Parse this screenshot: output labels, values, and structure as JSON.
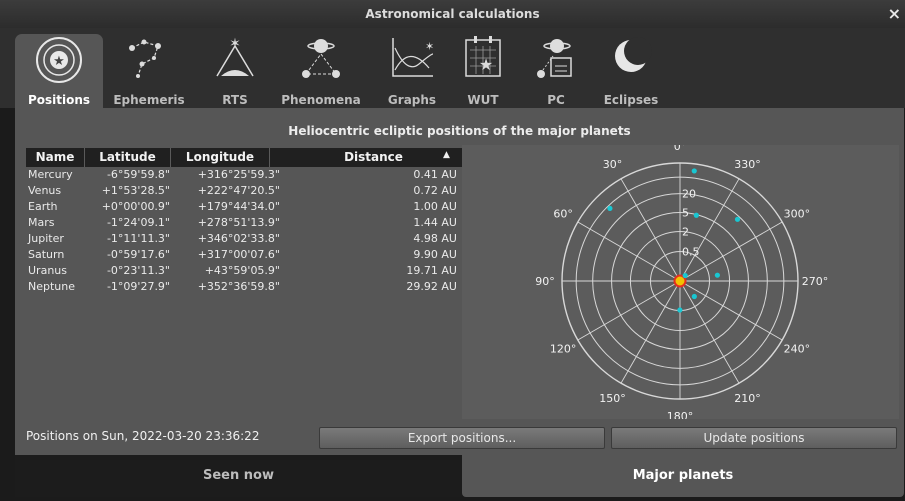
{
  "window": {
    "title": "Astronomical calculations",
    "close_glyph": "×"
  },
  "tabs": [
    {
      "label": "Positions",
      "icon": "solar-system-icon",
      "active": true
    },
    {
      "label": "Ephemeris",
      "icon": "constellation-icon"
    },
    {
      "label": "RTS",
      "icon": "rise-transit-set-icon"
    },
    {
      "label": "Phenomena",
      "icon": "conjunction-icon"
    },
    {
      "label": "Graphs",
      "icon": "graph-icon"
    },
    {
      "label": "WUT",
      "icon": "calendar-star-icon"
    },
    {
      "label": "PC",
      "icon": "planet-calendar-icon"
    },
    {
      "label": "Eclipses",
      "icon": "eclipse-icon"
    }
  ],
  "positions": {
    "heading": "Heliocentric ecliptic positions of the major planets",
    "columns": [
      "Name",
      "Latitude",
      "Longitude",
      "Distance"
    ],
    "rows": [
      {
        "name": "Mercury",
        "latitude": "-6°59'59.8\"",
        "longitude": "+316°25'59.3\"",
        "distance": "0.41 AU"
      },
      {
        "name": "Venus",
        "latitude": "+1°53'28.5\"",
        "longitude": "+222°47'20.5\"",
        "distance": "0.72 AU"
      },
      {
        "name": "Earth",
        "latitude": "+0°00'00.9\"",
        "longitude": "+179°44'34.0\"",
        "distance": "1.00 AU"
      },
      {
        "name": "Mars",
        "latitude": "-1°24'09.1\"",
        "longitude": "+278°51'13.9\"",
        "distance": "1.44 AU"
      },
      {
        "name": "Jupiter",
        "latitude": "-1°11'11.3\"",
        "longitude": "+346°02'33.8\"",
        "distance": "4.98 AU"
      },
      {
        "name": "Saturn",
        "latitude": "-0°59'17.6\"",
        "longitude": "+317°00'07.6\"",
        "distance": "9.90 AU"
      },
      {
        "name": "Uranus",
        "latitude": "-0°23'11.3\"",
        "longitude": "+43°59'05.9\"",
        "distance": "19.71 AU"
      },
      {
        "name": "Neptune",
        "latitude": "-1°09'27.9\"",
        "longitude": "+352°36'59.8\"",
        "distance": "29.92 AU"
      }
    ],
    "footer_text": "Positions on Sun, 2022-03-20 23:36:22",
    "export_label": "Export positions...",
    "update_label": "Update positions"
  },
  "chart_data": {
    "type": "scatter",
    "projection": "polar",
    "angle_labels": [
      "0°",
      "30°",
      "60°",
      "90°",
      "120°",
      "150°",
      "180°",
      "210°",
      "240°",
      "270°",
      "300°",
      "330°"
    ],
    "radial_labels": [
      "0.5",
      "2",
      "5",
      "20"
    ],
    "series": [
      {
        "points": [
          {
            "longitude": 316.43,
            "distance": 0.41
          },
          {
            "longitude": 222.79,
            "distance": 0.72
          },
          {
            "longitude": 179.74,
            "distance": 1.0
          },
          {
            "longitude": 278.85,
            "distance": 1.44
          },
          {
            "longitude": 346.04,
            "distance": 4.98
          },
          {
            "longitude": 317.0,
            "distance": 9.9
          },
          {
            "longitude": 43.98,
            "distance": 19.71
          },
          {
            "longitude": 352.62,
            "distance": 29.92
          }
        ]
      }
    ],
    "center_marker": "sun",
    "colors": {
      "points": "#19c7d2",
      "sun_fill": "#f2c200",
      "sun_ring": "#e03020",
      "grid": "#d8d8d8"
    }
  },
  "bottom_tabs": [
    {
      "label": "Seen now",
      "active": false
    },
    {
      "label": "Major planets",
      "active": true
    }
  ]
}
